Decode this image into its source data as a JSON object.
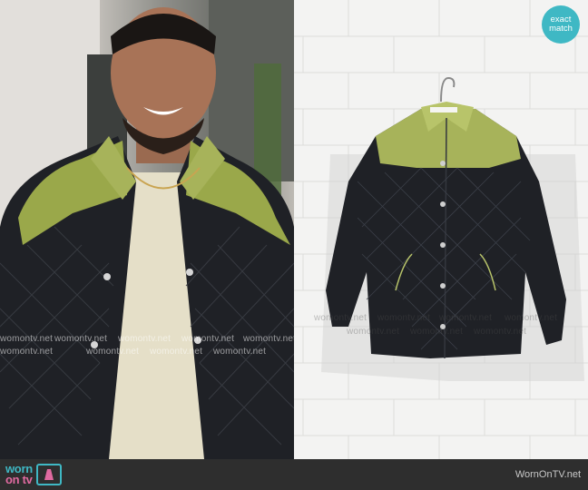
{
  "badge": {
    "line1": "exact",
    "line2": "match"
  },
  "watermark": "womontv.net",
  "footer": {
    "logo_worn": "worn",
    "logo_ontv": "on tv",
    "site": "WornOnTV.net"
  },
  "colors": {
    "accent": "#3fb8c4",
    "pink": "#e06aa0",
    "jacket": "#1f2126",
    "yoke": "#9aa84a",
    "footer": "#2e2e2e"
  }
}
